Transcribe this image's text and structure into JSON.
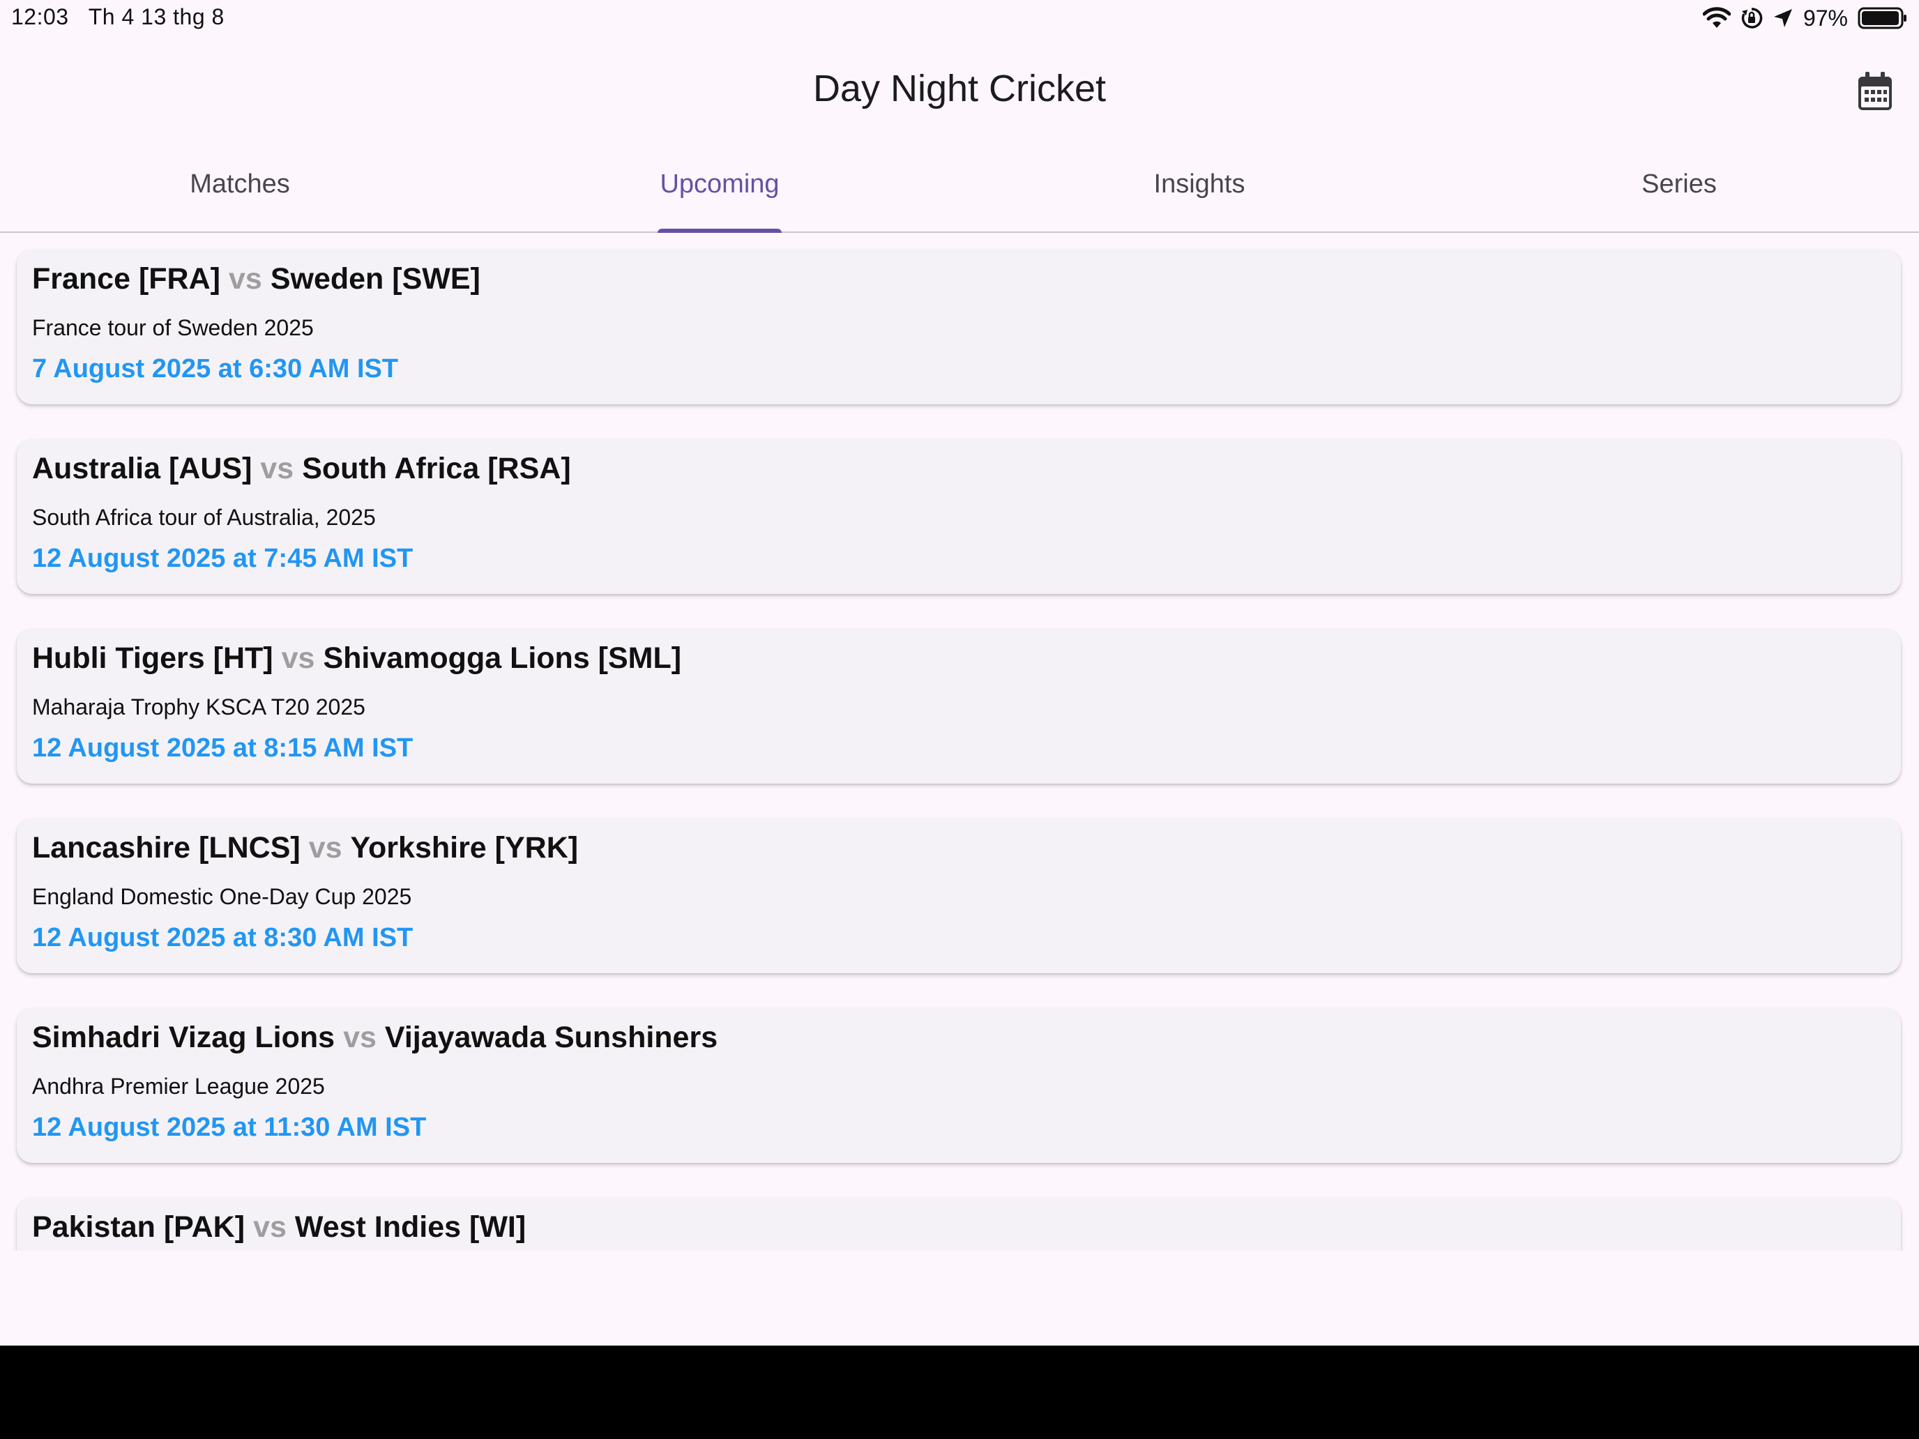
{
  "status_bar": {
    "time": "12:03",
    "date": "Th 4 13 thg 8",
    "battery": "97%",
    "icons": [
      "wifi-icon",
      "orientation-lock-icon",
      "location-arrow-icon",
      "battery-icon"
    ]
  },
  "header": {
    "title": "Day Night Cricket",
    "calendar_icon": "calendar-icon"
  },
  "tabs": [
    {
      "label": "Matches",
      "active": false
    },
    {
      "label": "Upcoming",
      "active": true
    },
    {
      "label": "Insights",
      "active": false
    },
    {
      "label": "Series",
      "active": false
    }
  ],
  "matches": [
    {
      "team1": "France [FRA]",
      "vs": "vs",
      "team2": "Sweden [SWE]",
      "series": "France tour of Sweden 2025",
      "datetime": "7 August 2025 at 6:30 AM IST"
    },
    {
      "team1": "Australia [AUS]",
      "vs": "vs",
      "team2": "South Africa [RSA]",
      "series": "South Africa tour of Australia, 2025",
      "datetime": "12 August 2025 at 7:45 AM IST"
    },
    {
      "team1": "Hubli Tigers [HT]",
      "vs": "vs",
      "team2": "Shivamogga Lions [SML]",
      "series": "Maharaja Trophy KSCA T20 2025",
      "datetime": "12 August 2025 at 8:15 AM IST"
    },
    {
      "team1": "Lancashire [LNCS]",
      "vs": "vs",
      "team2": "Yorkshire [YRK]",
      "series": "England Domestic One-Day Cup 2025",
      "datetime": "12 August 2025 at 8:30 AM IST"
    },
    {
      "team1": "Simhadri Vizag Lions",
      "vs": "vs",
      "team2": "Vijayawada Sunshiners",
      "series": "Andhra Premier League 2025",
      "datetime": "12 August 2025 at 11:30 AM IST"
    },
    {
      "team1": "Pakistan [PAK]",
      "vs": "vs",
      "team2": "West Indies [WI]",
      "series": "",
      "datetime": ""
    }
  ],
  "colors": {
    "background": "#fdf7fd",
    "accent": "#6750a4",
    "datetime": "#2196f3",
    "card": "#f5f2f7",
    "vs": "#9e9e9e"
  }
}
